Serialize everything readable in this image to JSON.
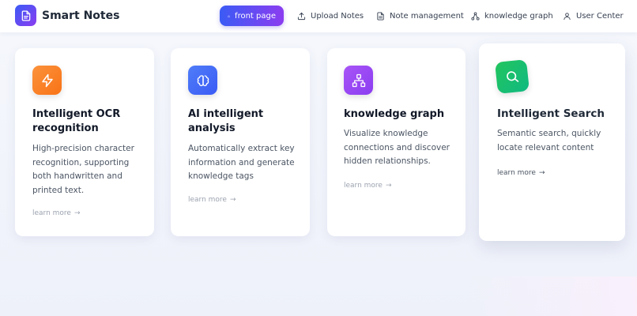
{
  "header": {
    "brand": "Smart Notes",
    "nav": [
      {
        "label": "front page",
        "icon": "home-icon",
        "active": true
      },
      {
        "label": "Upload Notes",
        "icon": "upload-icon",
        "active": false
      },
      {
        "label": "Note management",
        "icon": "document-icon",
        "active": false
      },
      {
        "label": "knowledge graph",
        "icon": "graph-icon",
        "active": false
      },
      {
        "label": "User Center",
        "icon": "user-icon",
        "active": false
      }
    ]
  },
  "cards": [
    {
      "title_line1": "Intelligent OCR",
      "title_line2": "recognition",
      "desc_lines": [
        "High-precision character",
        "recognition, supporting",
        "both handwritten and",
        "printed text."
      ],
      "more": "learn more",
      "icon": "lightning-icon",
      "color": "#f97316"
    },
    {
      "title_line1": "AI intelligent",
      "title_line2": "analysis",
      "desc_lines": [
        "Automatically extract key",
        "information and generate",
        "knowledge tags"
      ],
      "more": "learn more",
      "icon": "brain-icon",
      "color": "#3b6cf6"
    },
    {
      "title_line1": "knowledge graph",
      "desc_lines": [
        "Visualize knowledge",
        "connections and discover",
        "hidden relationships."
      ],
      "more": "learn more",
      "icon": "network-icon",
      "color": "#9b4df0"
    },
    {
      "title_line1": "Intelligent Search",
      "desc_lines": [
        "Semantic search, quickly",
        "locate relevant content"
      ],
      "more": "learn more",
      "icon": "search-icon",
      "color": "#16c06a"
    }
  ]
}
